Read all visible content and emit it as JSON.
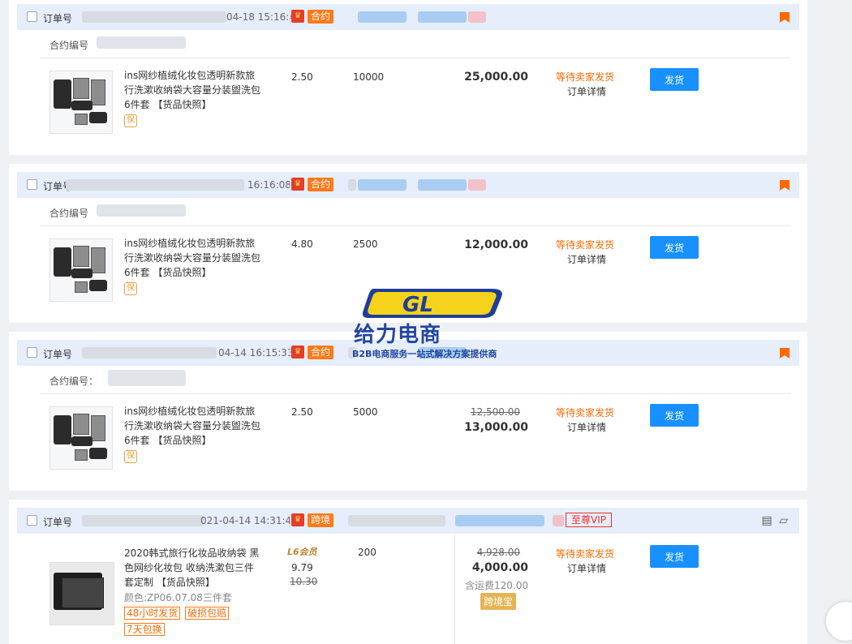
{
  "labels": {
    "order_no": "订单号",
    "contract_no": "合约编号",
    "contract_no_colon": "合约编号：",
    "ship": "发货",
    "detail": "订单详情",
    "status_waiting": "等待卖家发货",
    "snapshot": "【货品快照】",
    "bao": "保"
  },
  "orders": [
    {
      "time": "04-18 15:16:41",
      "tag": "合约",
      "product_title": "ins网纱植绒化妆包透明新款旅行洗漱收纳袋大容量分装盥洗包6件套",
      "unit_price": "2.50",
      "quantity": "10000",
      "total": "25,000.00"
    },
    {
      "time": "16:16:08",
      "tag": "合约",
      "product_title": "ins网纱植绒化妆包透明新款旅行洗漱收纳袋大容量分装盥洗包6件套",
      "unit_price": "4.80",
      "quantity": "2500",
      "total": "12,000.00"
    },
    {
      "time": "04-14 16:15:33",
      "tag": "合约",
      "product_title": "ins网纱植绒化妆包透明新款旅行洗漱收纳袋大容量分装盥洗包6件套",
      "unit_price": "2.50",
      "quantity": "5000",
      "original_total": "12,500.00",
      "total": "13,000.00"
    },
    {
      "time": "021-04-14 14:31:43",
      "tag": "跨境",
      "vip": "至尊VIP",
      "product_title": "2020韩式旅行化妆品收纳袋 黑色网纱化妆包 收纳洗漱包三件套定制",
      "attribute": "颜色:ZP06.07.08三件套",
      "badges": [
        "48小时发货",
        "破损包赔",
        "7天包换"
      ],
      "member_level": "L6会员",
      "unit_price": "9.79",
      "original_unit_price": "10.30",
      "quantity": "200",
      "original_total": "4,928.00",
      "total": "4,000.00",
      "freight": "含运费120.00",
      "cross_border_badge": "跨境宝"
    }
  ],
  "watermark": {
    "brand_cn": "给力电商",
    "tagline": "B2B电商服务一站式解决方案提供商"
  },
  "colors": {
    "accent_blue": "#1890ff",
    "status_orange": "#ff6a00",
    "header_bg": "#e5eefa",
    "tag_orange": "#ff7a1a"
  }
}
